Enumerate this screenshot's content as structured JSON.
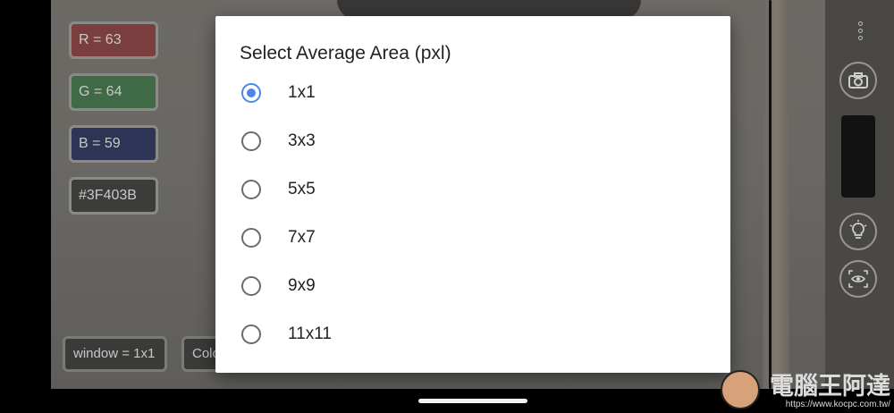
{
  "readouts": {
    "r": "R = 63",
    "g": "G = 64",
    "b": "B = 59",
    "hex": "#3F403B",
    "window": "window = 1x1",
    "color_partial": "Colo"
  },
  "dialog": {
    "title": "Select Average Area (pxl)",
    "options": [
      {
        "label": "1x1",
        "selected": true
      },
      {
        "label": "3x3",
        "selected": false
      },
      {
        "label": "5x5",
        "selected": false
      },
      {
        "label": "7x7",
        "selected": false
      },
      {
        "label": "9x9",
        "selected": false
      },
      {
        "label": "11x11",
        "selected": false
      }
    ]
  },
  "rail": {
    "icons": [
      "more-vert-icon",
      "camera-icon",
      "light-bulb-icon",
      "eye-scan-icon"
    ]
  },
  "watermark": {
    "text": "電腦王阿達",
    "url": "https://www.kocpc.com.tw/"
  },
  "colors": {
    "accent": "#4a88e8",
    "red_chip": "#7a3e3e",
    "green_chip": "#3f6a45",
    "blue_chip": "#2e3455",
    "hex_chip": "#3c3c3a"
  }
}
